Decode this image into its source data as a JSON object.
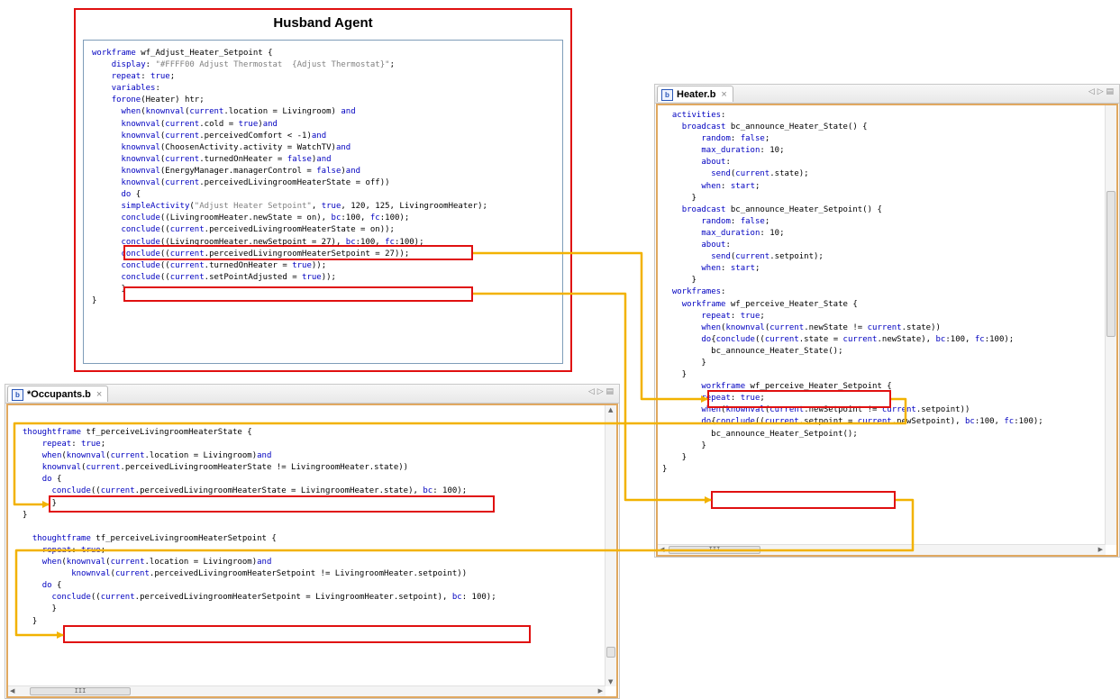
{
  "husband": {
    "title": "Husband Agent",
    "lines": [
      "workframe wf_Adjust_Heater_Setpoint {",
      "    display: \"#FFFF00 Adjust Thermostat  {Adjust Thermostat}\";",
      "    repeat: true;",
      "    variables:",
      "    forone(Heater) htr;",
      "      when(knownval(current.location = Livingroom) and",
      "      knownval(current.cold = true)and",
      "      knownval(current.perceivedComfort < -1)and",
      "      knownval(ChoosenActivity.activity = WatchTV)and",
      "      knownval(current.turnedOnHeater = false)and",
      "      knownval(EnergyManager.managerControl = false)and",
      "      knownval(current.perceivedLivingroomHeaterState = off))",
      "      do {",
      "      simpleActivity(\"Adjust Heater Setpoint\", true, 120, 125, LivingroomHeater);",
      "      conclude((LivingroomHeater.newState = on), bc:100, fc:100);",
      "      conclude((current.perceivedLivingroomHeaterState = on));",
      "      conclude((LivingroomHeater.newSetpoint = 27), bc:100, fc:100);",
      "      conclude((current.perceivedLivingroomHeaterSetpoint = 27));",
      "      conclude((current.turnedOnHeater = true));",
      "      conclude((current.setPointAdjusted = true));",
      "      }",
      "}"
    ]
  },
  "heater": {
    "tab": "Heater.b",
    "lines": [
      "  activities:",
      "    broadcast bc_announce_Heater_State() {",
      "        random: false;",
      "        max_duration: 10;",
      "        about:",
      "          send(current.state);",
      "        when: start;",
      "      }",
      "    broadcast bc_announce_Heater_Setpoint() {",
      "        random: false;",
      "        max_duration: 10;",
      "        about:",
      "          send(current.setpoint);",
      "        when: start;",
      "      }",
      "  workframes:",
      "    workframe wf_perceive_Heater_State {",
      "        repeat: true;",
      "        when(knownval(current.newState != current.state))",
      "        do{conclude((current.state = current.newState), bc:100, fc:100);",
      "          bc_announce_Heater_State();",
      "        }",
      "    }",
      "        workframe wf_perceive_Heater_Setpoint {",
      "        repeat: true;",
      "        when(knownval(current.newSetpoint != current.setpoint))",
      "        do{conclude((current.setpoint = current.newSetpoint), bc:100, fc:100);",
      "          bc_announce_Heater_Setpoint();",
      "        }",
      "    }",
      "}"
    ]
  },
  "occupants": {
    "tab": "*Occupants.b",
    "lines": [
      "thoughtframe tf_perceiveLivingroomHeaterState {",
      "    repeat: true;",
      "    when(knownval(current.location = Livingroom)and",
      "    knownval(current.perceivedLivingroomHeaterState != LivingroomHeater.state))",
      "    do {",
      "      conclude((current.perceivedLivingroomHeaterState = LivingroomHeater.state), bc: 100);",
      "      }",
      "}",
      "",
      "  thoughtframe tf_perceiveLivingroomHeaterSetpoint {",
      "    repeat: true;",
      "    when(knownval(current.location = Livingroom)and",
      "          knownval(current.perceivedLivingroomHeaterSetpoint != LivingroomHeater.setpoint))",
      "    do {",
      "      conclude((current.perceivedLivingroomHeaterSetpoint = LivingroomHeater.setpoint), bc: 100);",
      "      }",
      "  }"
    ]
  },
  "ui": {
    "close": "×",
    "tab_controls": "◁ ▷ ▤",
    "scroll_up": "▲",
    "scroll_down": "▼",
    "scroll_left": "◀",
    "scroll_right": "▶",
    "thumb_grip": "III",
    "file_icon": "b"
  },
  "colors": {
    "highlight": "#e01010",
    "connector": "#f2b200",
    "keyword": "#0000c0",
    "string": "#808080"
  }
}
